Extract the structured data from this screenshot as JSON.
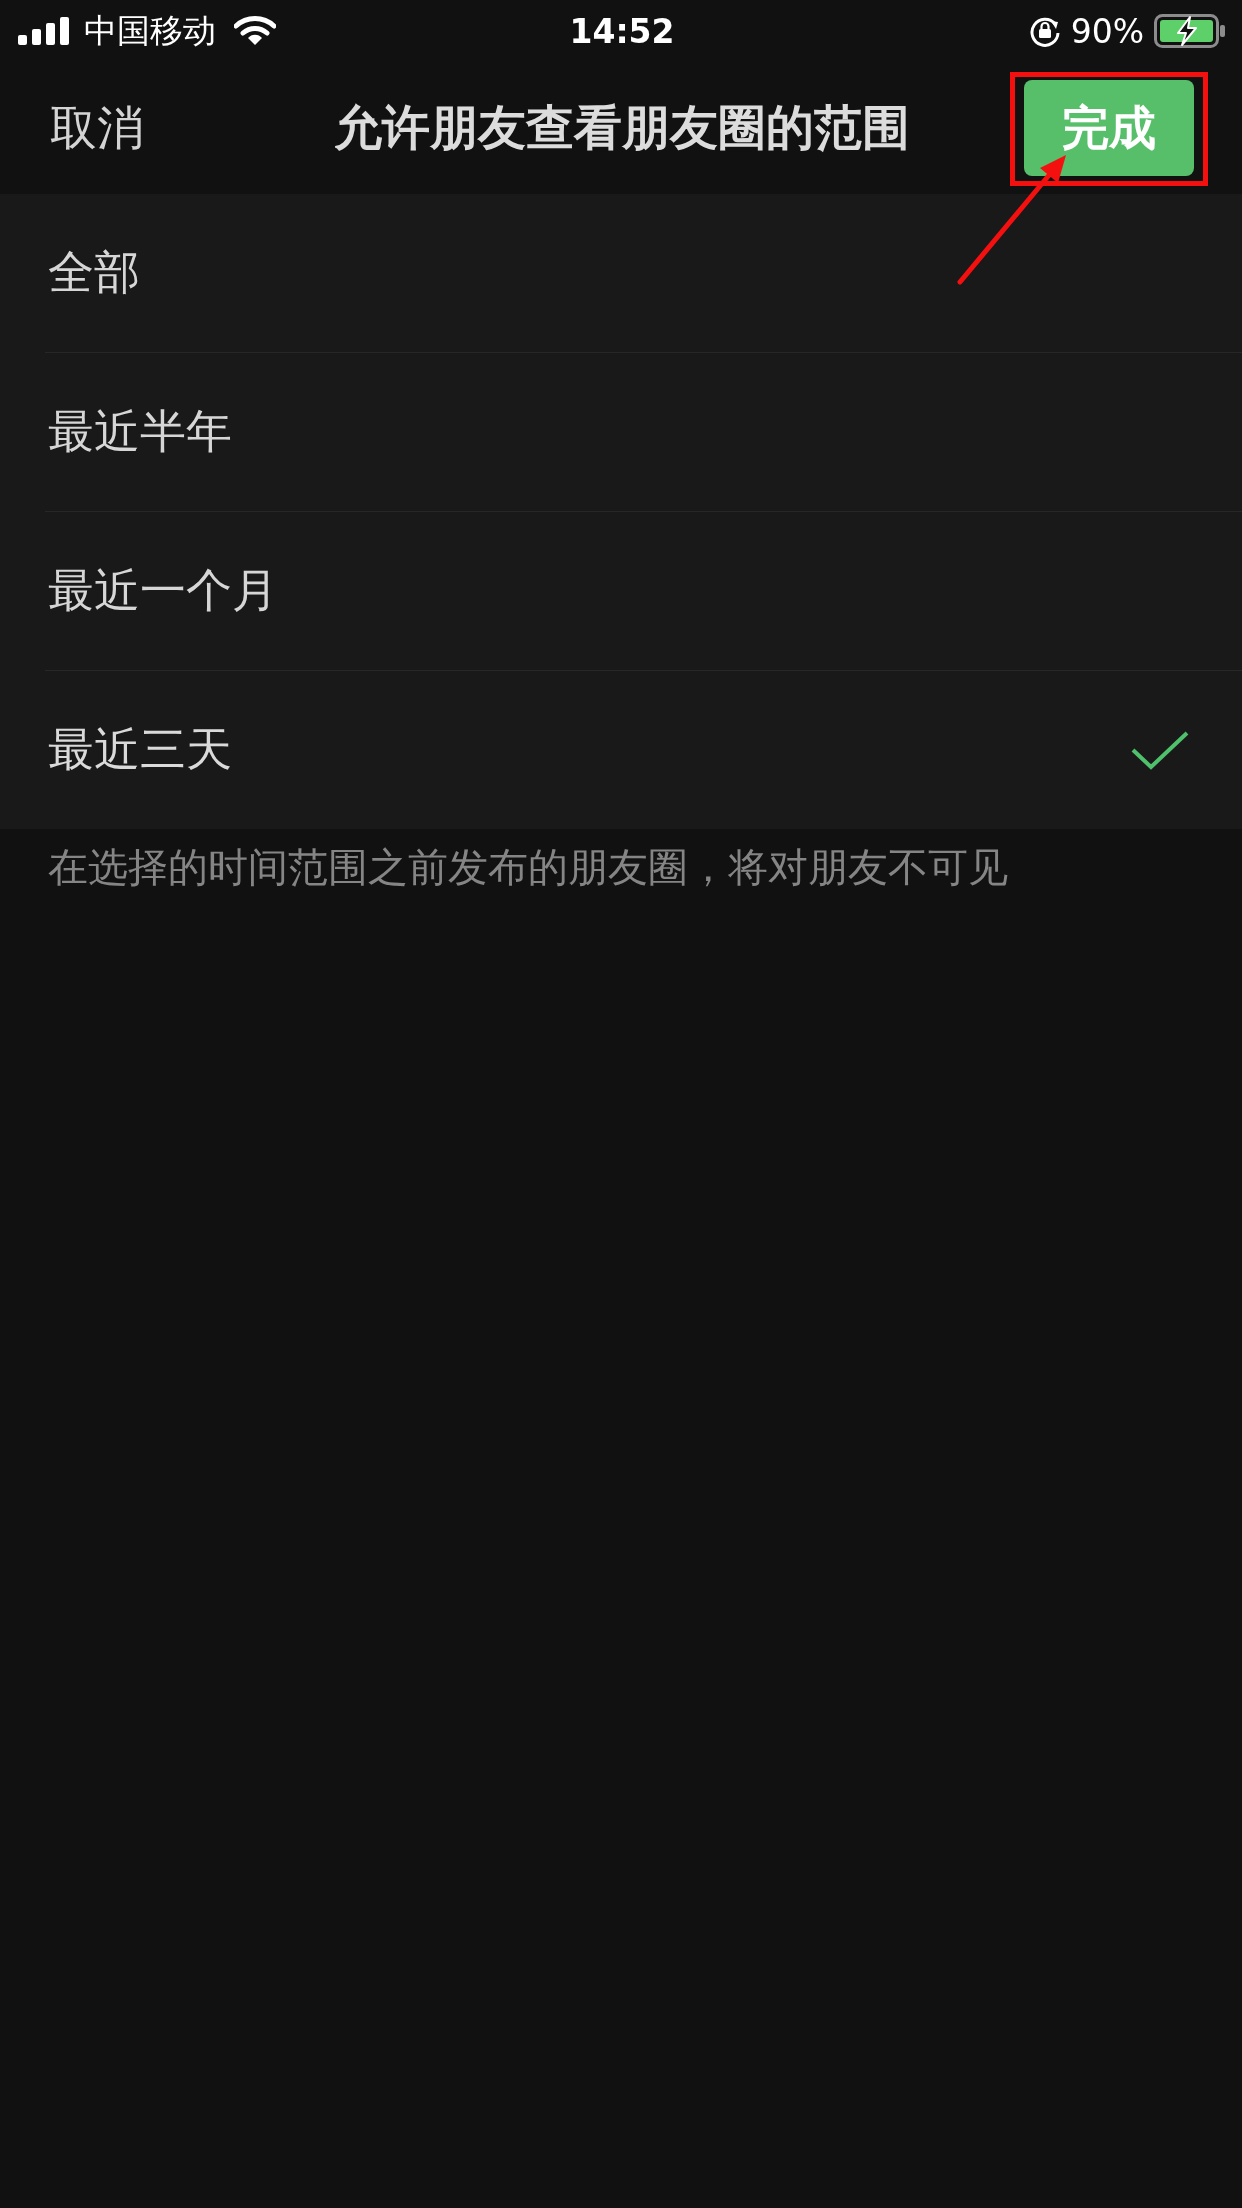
{
  "status_bar": {
    "carrier": "中国移动",
    "time": "14:52",
    "battery_percent": "90%"
  },
  "nav_bar": {
    "cancel": "取消",
    "title": "允许朋友查看朋友圈的范围",
    "done": {
      "label": "完成",
      "highlighted": true
    }
  },
  "options": [
    {
      "label": "全部",
      "selected": false
    },
    {
      "label": "最近半年",
      "selected": false
    },
    {
      "label": "最近一个月",
      "selected": false
    },
    {
      "label": "最近三天",
      "selected": true
    }
  ],
  "footnote": "在选择的时间范围之前发布的朋友圈，将对朋友不可见"
}
